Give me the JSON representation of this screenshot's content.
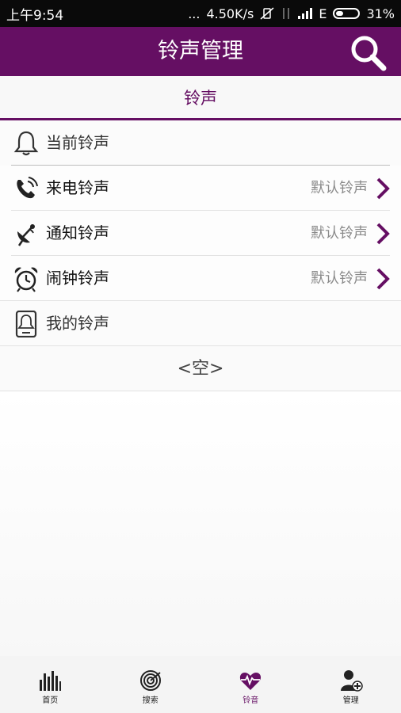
{
  "status_bar": {
    "time": "上午9:54",
    "dots": "...",
    "speed": "4.50K/s",
    "network": "E",
    "battery": "31%"
  },
  "header": {
    "title": "铃声管理",
    "search_icon": "search-icon",
    "brand_color": "#650f63"
  },
  "tab": {
    "label": "铃声"
  },
  "current_section": {
    "label": "当前铃声",
    "icon": "bell-icon"
  },
  "ringtone_items": [
    {
      "label": "来电铃声",
      "value": "默认铃声",
      "icon": "phone-ring-icon"
    },
    {
      "label": "通知铃声",
      "value": "默认铃声",
      "icon": "satellite-dish-icon"
    },
    {
      "label": "闹钟铃声",
      "value": "默认铃声",
      "icon": "alarm-clock-icon"
    }
  ],
  "my_section": {
    "label": "我的铃声",
    "icon": "phone-bell-icon"
  },
  "empty_text": "<空>",
  "bottom_nav": [
    {
      "label": "首页",
      "icon": "equalizer-icon"
    },
    {
      "label": "搜索",
      "icon": "radar-icon"
    },
    {
      "label": "铃音",
      "icon": "heartbeat-icon",
      "active": true
    },
    {
      "label": "管理",
      "icon": "user-add-icon"
    }
  ]
}
